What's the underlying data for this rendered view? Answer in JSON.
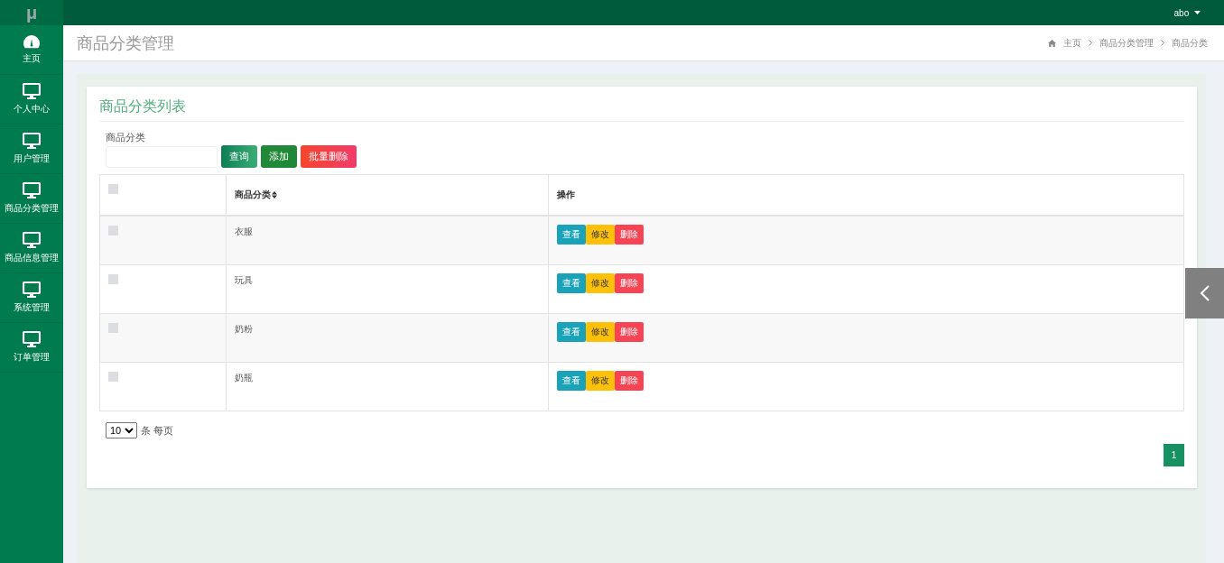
{
  "logo": "μ",
  "user_menu": {
    "label": "abo"
  },
  "sidebar": {
    "items": [
      {
        "label": "主页"
      },
      {
        "label": "个人中心"
      },
      {
        "label": "用户管理"
      },
      {
        "label": "商品分类管理"
      },
      {
        "label": "商品信息管理"
      },
      {
        "label": "系统管理"
      },
      {
        "label": "订单管理"
      }
    ]
  },
  "page_title": "商品分类管理",
  "breadcrumb": [
    "主页",
    "商品分类管理",
    "商品分类"
  ],
  "card": {
    "title": "商品分类列表",
    "search": {
      "label": "商品分类"
    },
    "buttons": [
      {
        "label": "查询",
        "kind": "search"
      },
      {
        "label": "添加",
        "kind": "add"
      },
      {
        "label": "批量删除",
        "kind": "delete"
      }
    ],
    "table": {
      "select_all_checked": false,
      "columns": [
        "商品分类",
        "操作"
      ],
      "rows": [
        {
          "checked": false,
          "category": "衣服",
          "actions": [
            "查看",
            "修改",
            "删除"
          ]
        },
        {
          "checked": false,
          "category": "玩具",
          "actions": [
            "查看",
            "修改",
            "删除"
          ]
        },
        {
          "checked": false,
          "category": "奶粉",
          "actions": [
            "查看",
            "修改",
            "删除"
          ]
        },
        {
          "checked": false,
          "category": "奶瓶",
          "actions": [
            "查看",
            "修改",
            "删除"
          ]
        }
      ]
    },
    "page_size": {
      "value": "10",
      "suffix": "条 每页"
    },
    "pages": [
      {
        "label": "1",
        "selected": true
      }
    ]
  }
}
